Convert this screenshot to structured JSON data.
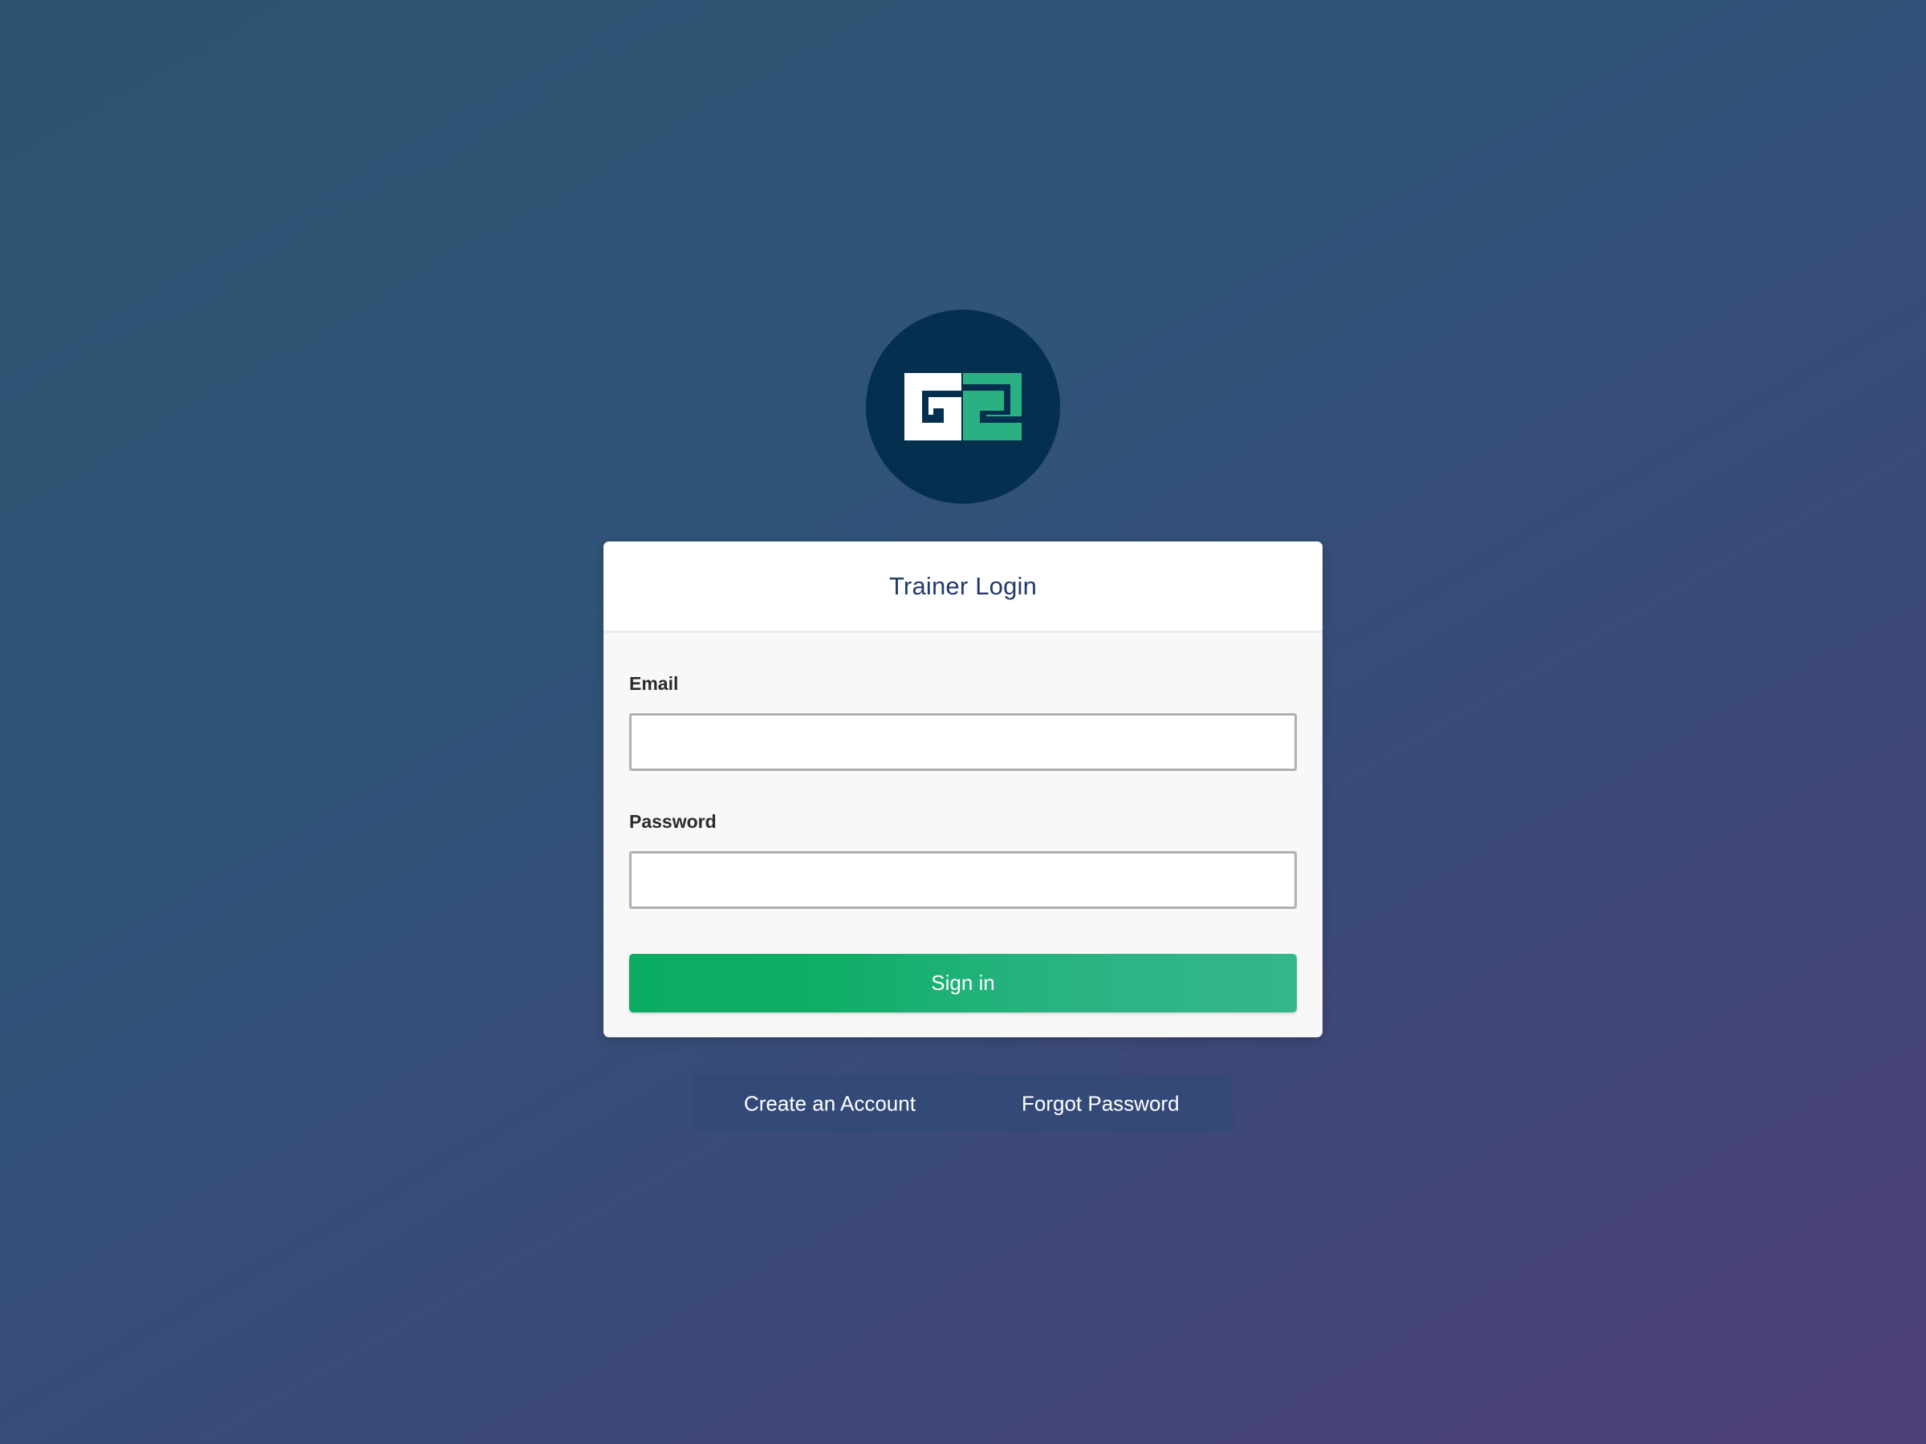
{
  "logo": {
    "icon": "g2-logo-icon",
    "colors": {
      "circle": "#042f4f",
      "left_block": "#ffffff",
      "right_block": "#2bb082"
    }
  },
  "login_card": {
    "title": "Trainer Login",
    "email": {
      "label": "Email",
      "value": "",
      "placeholder": ""
    },
    "password": {
      "label": "Password",
      "value": "",
      "placeholder": ""
    },
    "signin_label": "Sign in"
  },
  "footer_links": {
    "create_account": "Create an Account",
    "forgot_password": "Forgot Password"
  },
  "colors": {
    "title": "#223a6b",
    "signin_start": "#0aab63",
    "signin_end": "#36b68d"
  }
}
